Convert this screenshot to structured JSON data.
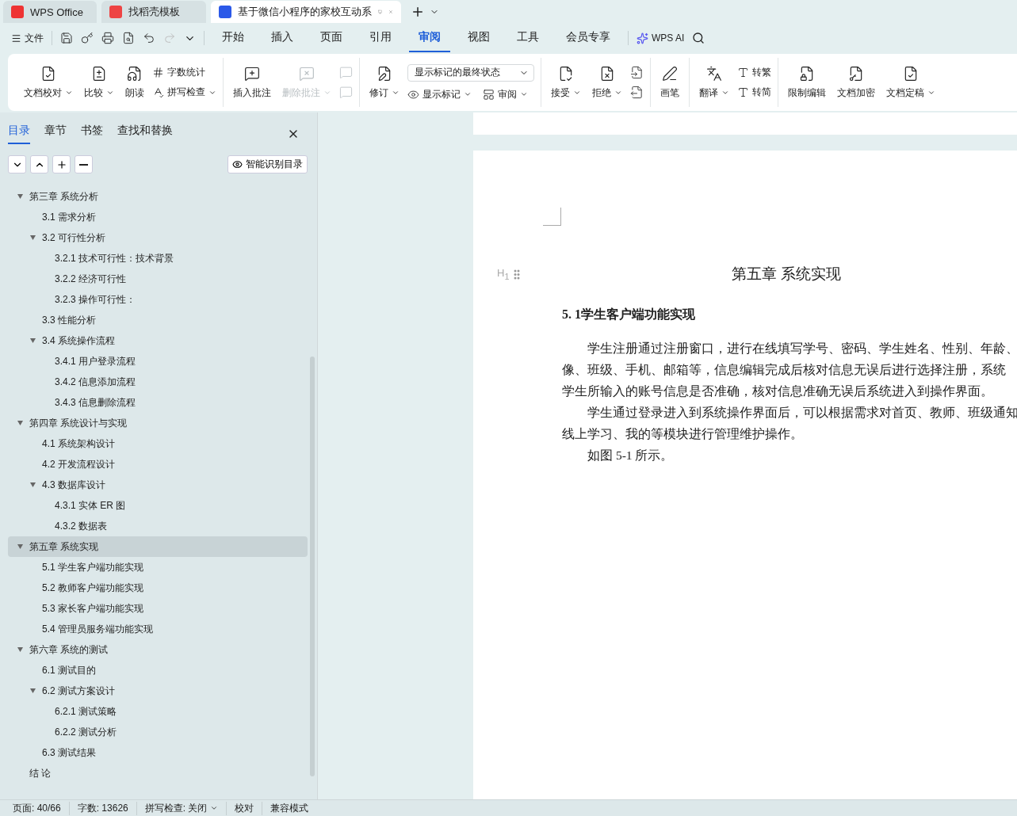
{
  "app_tabs": [
    {
      "label": "WPS Office",
      "selected": false
    },
    {
      "label": "找稻壳模板",
      "selected": false
    },
    {
      "label": "基于微信小程序的家校互动系",
      "selected": true
    }
  ],
  "menu": {
    "file": "文件",
    "tabs": [
      {
        "label": "开始",
        "selected": false
      },
      {
        "label": "插入",
        "selected": false
      },
      {
        "label": "页面",
        "selected": false
      },
      {
        "label": "引用",
        "selected": false
      },
      {
        "label": "审阅",
        "selected": true
      },
      {
        "label": "视图",
        "selected": false
      },
      {
        "label": "工具",
        "selected": false
      },
      {
        "label": "会员专享",
        "selected": false
      }
    ],
    "ai": "WPS AI"
  },
  "ribbon": [
    {
      "items": [
        {
          "kind": "large",
          "label": "文档校对",
          "dropdown": true,
          "disabled": false
        },
        {
          "kind": "large",
          "label": "比较",
          "dropdown": true,
          "disabled": false
        },
        {
          "kind": "large",
          "label": "朗读",
          "dropdown": false,
          "disabled": false
        },
        {
          "kind": "stack",
          "items": [
            {
              "label": "字数统计",
              "dropdown": false,
              "disabled": false
            },
            {
              "label": "拼写检查",
              "dropdown": true,
              "disabled": false
            }
          ]
        }
      ]
    },
    {
      "items": [
        {
          "kind": "large",
          "label": "插入批注",
          "dropdown": false,
          "disabled": false
        },
        {
          "kind": "large",
          "label": "删除批注",
          "dropdown": true,
          "disabled": true
        },
        {
          "kind": "icons",
          "disabled": true
        }
      ]
    },
    {
      "items": [
        {
          "kind": "large",
          "label": "修订",
          "dropdown": true,
          "disabled": false
        },
        {
          "kind": "select",
          "value": "显示标记的最终状态",
          "items": [
            {
              "label": "显示标记",
              "dropdown": true,
              "disabled": false
            },
            {
              "label": "审阅",
              "dropdown": true,
              "disabled": false
            }
          ]
        }
      ]
    },
    {
      "items": [
        {
          "kind": "large",
          "label": "接受",
          "dropdown": true,
          "disabled": false
        },
        {
          "kind": "large",
          "label": "拒绝",
          "dropdown": true,
          "disabled": false
        },
        {
          "kind": "icons",
          "disabled": false
        }
      ]
    },
    {
      "items": [
        {
          "kind": "large",
          "label": "画笔",
          "dropdown": false,
          "disabled": false
        }
      ]
    },
    {
      "items": [
        {
          "kind": "large",
          "label": "翻译",
          "dropdown": true,
          "disabled": false
        },
        {
          "kind": "stack",
          "items": [
            {
              "label": "转繁",
              "dropdown": false,
              "disabled": false
            },
            {
              "label": "转简",
              "dropdown": false,
              "disabled": false
            }
          ]
        }
      ]
    },
    {
      "items": [
        {
          "kind": "large",
          "label": "限制编辑",
          "dropdown": false,
          "disabled": false
        },
        {
          "kind": "large",
          "label": "文档加密",
          "dropdown": false,
          "disabled": false
        },
        {
          "kind": "large",
          "label": "文档定稿",
          "dropdown": true,
          "disabled": false
        }
      ]
    }
  ],
  "sidebar": {
    "tabs": [
      {
        "label": "目录",
        "selected": true
      },
      {
        "label": "章节",
        "selected": false
      },
      {
        "label": "书签",
        "selected": false
      },
      {
        "label": "查找和替换",
        "selected": false
      }
    ],
    "smart_button": "智能识别目录",
    "outline": [
      {
        "label": "第三章  系统分析",
        "expanded": true,
        "selected": false,
        "children": [
          {
            "label": "3.1 需求分析",
            "selected": false
          },
          {
            "label": "3.2 可行性分析",
            "expanded": true,
            "selected": false,
            "children": [
              {
                "label": "3.2.1 技术可行性：技术背景",
                "selected": false
              },
              {
                "label": "3.2.2 经济可行性",
                "selected": false
              },
              {
                "label": "3.2.3 操作可行性：",
                "selected": false
              }
            ]
          },
          {
            "label": "3.3 性能分析",
            "selected": false
          },
          {
            "label": "3.4 系统操作流程",
            "expanded": true,
            "selected": false,
            "children": [
              {
                "label": "3.4.1 用户登录流程",
                "selected": false
              },
              {
                "label": "3.4.2 信息添加流程",
                "selected": false
              },
              {
                "label": "3.4.3 信息删除流程",
                "selected": false
              }
            ]
          }
        ]
      },
      {
        "label": "第四章  系统设计与实现",
        "expanded": true,
        "selected": false,
        "children": [
          {
            "label": "4.1 系统架构设计",
            "selected": false
          },
          {
            "label": "4.2 开发流程设计",
            "selected": false
          },
          {
            "label": "4.3 数据库设计",
            "expanded": true,
            "selected": false,
            "children": [
              {
                "label": "4.3.1 实体 ER 图",
                "selected": false
              },
              {
                "label": "4.3.2 数据表",
                "selected": false
              }
            ]
          }
        ]
      },
      {
        "label": "第五章  系统实现",
        "expanded": true,
        "selected": true,
        "children": [
          {
            "label": "5.1 学生客户端功能实现",
            "selected": false
          },
          {
            "label": "5.2 教师客户端功能实现",
            "selected": false
          },
          {
            "label": "5.3 家长客户端功能实现",
            "selected": false
          },
          {
            "label": "5.4  管理员服务端功能实现",
            "selected": false
          }
        ]
      },
      {
        "label": "第六章    系统的测试",
        "expanded": true,
        "selected": false,
        "children": [
          {
            "label": "6.1  测试目的",
            "selected": false
          },
          {
            "label": "6.2  测试方案设计",
            "expanded": true,
            "selected": false,
            "children": [
              {
                "label": "6.2.1  测试策略",
                "selected": false
              },
              {
                "label": "6.2.2  测试分析",
                "selected": false
              }
            ]
          },
          {
            "label": "6.3  测试结果",
            "selected": false
          }
        ]
      },
      {
        "label": "结    论",
        "selected": false
      }
    ]
  },
  "document": {
    "heading_marker": "H$_{1}$",
    "heading": "第五章  系统实现",
    "subheading": "5. 1学生客户端功能实现",
    "paragraphs": [
      {
        "lines": [
          "学生注册通过注册窗口，进行在线填写学号、密码、学生姓名、性别、年龄、",
          "像、班级、手机、邮箱等，信息编辑完成后核对信息无误后进行选择注册，系统",
          "学生所输入的账号信息是否准确，核对信息准确无误后系统进入到操作界面。"
        ]
      },
      {
        "lines": [
          "学生通过登录进入到系统操作界面后，可以根据需求对首页、教师、班级通知",
          "线上学习、我的等模块进行管理维护操作。"
        ]
      },
      {
        "lines": [
          "如图 5-1 所示。"
        ]
      }
    ]
  },
  "status_bar": [
    {
      "label": "页面: 40/66",
      "dropdown": false
    },
    {
      "label": "字数: 13626",
      "dropdown": false
    },
    {
      "label": "拼写检查: 关闭",
      "dropdown": true
    },
    {
      "label": "校对",
      "dropdown": false
    },
    {
      "label": "兼容模式",
      "dropdown": false
    }
  ]
}
